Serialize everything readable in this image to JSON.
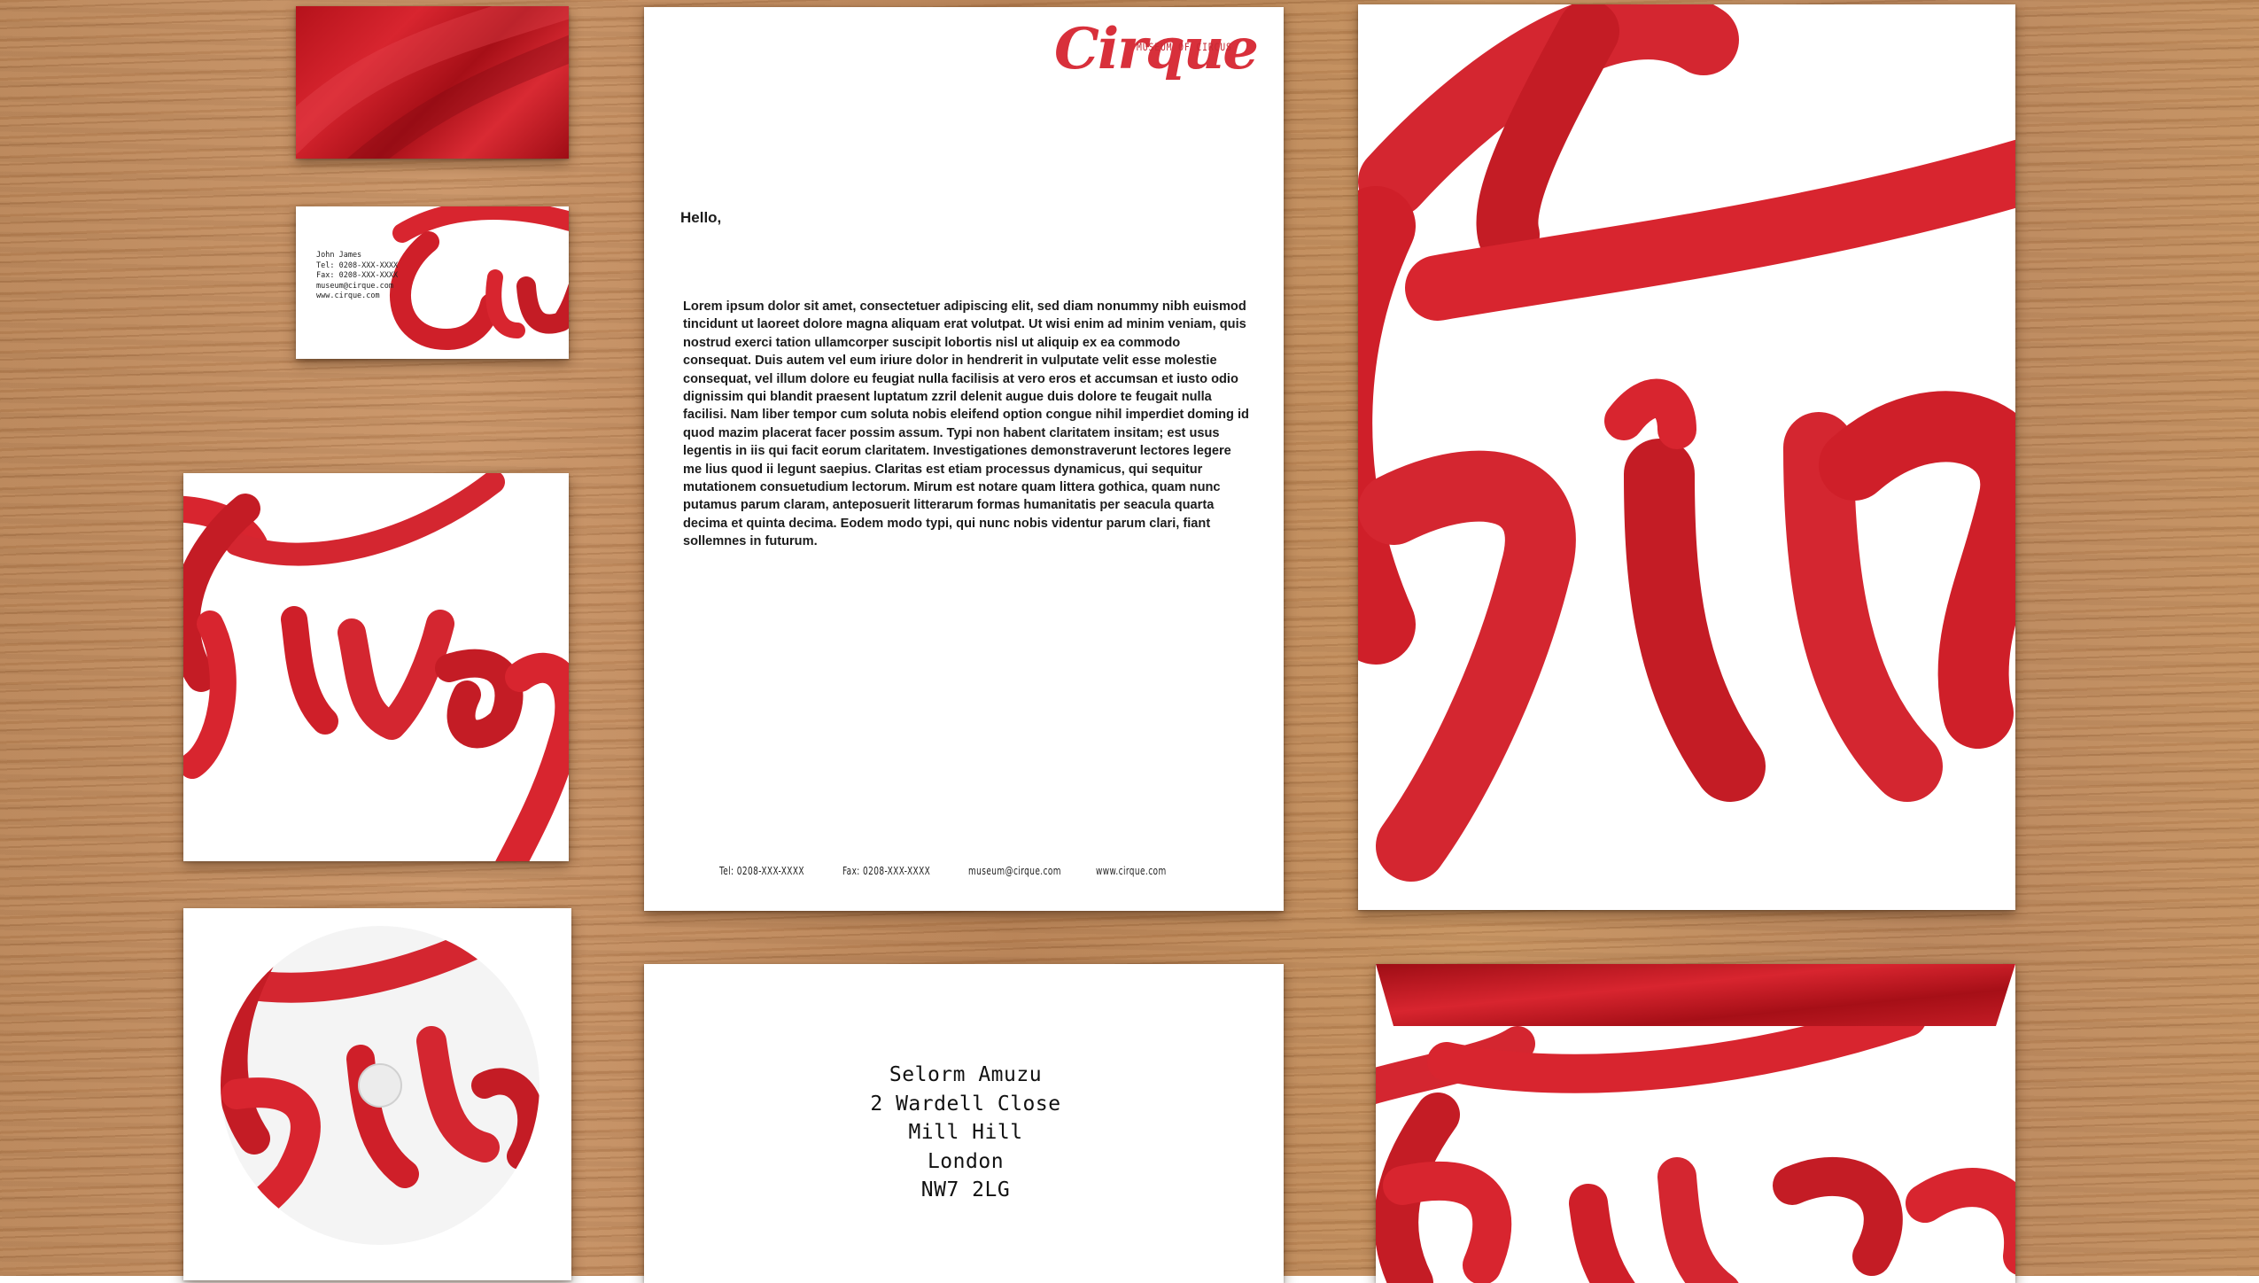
{
  "logo": {
    "wordmark": "Cirque",
    "tagline": "MUSEUM OF CIRCUS"
  },
  "business_card": {
    "lines": [
      "John James",
      "Tel: 0208-XXX-XXXX",
      "Fax: 0208-XXX-XXXX",
      "museum@cirque.com",
      "www.cirque.com"
    ]
  },
  "letterhead": {
    "greeting": "Hello,",
    "body": "Lorem ipsum dolor sit amet, consectetuer adipiscing elit, sed diam nonummy nibh euismod tincidunt ut laoreet dolore magna aliquam erat volutpat. Ut wisi enim ad minim veniam, quis nostrud exerci tation ullamcorper suscipit lobortis nisl ut aliquip ex ea commodo consequat. Duis autem vel eum iriure dolor in hendrerit in vulputate velit esse molestie consequat, vel illum dolore eu feugiat nulla facilisis at vero eros et accumsan et iusto odio dignissim qui blandit praesent luptatum zzril delenit augue duis dolore te feugait nulla facilisi. Nam liber tempor cum soluta nobis eleifend option congue nihil imperdiet doming id quod mazim placerat facer possim assum. Typi non habent claritatem insitam; est usus legentis in iis qui facit eorum claritatem. Investigationes demonstraverunt lectores legere me lius quod ii legunt saepius. Claritas est etiam processus dynamicus, qui sequitur mutationem consuetudium lectorum. Mirum est notare quam littera gothica, quam nunc putamus parum claram, anteposuerit litterarum formas humanitatis per seacula quarta decima et quinta decima. Eodem modo typi, qui nunc nobis videntur parum clari, fiant sollemnes in futurum.",
    "footer": {
      "tel": "Tel: 0208-XXX-XXXX",
      "fax": "Fax: 0208-XXX-XXXX",
      "email": "museum@cirque.com",
      "web": "www.cirque.com"
    }
  },
  "envelope": {
    "address": [
      "Selorm Amuzu",
      "2 Wardell Close",
      "Mill Hill",
      "London",
      "NW7 2LG"
    ]
  },
  "colors": {
    "brand_red": "#d8252f",
    "ribbon_dark": "#a8141c",
    "paper": "#ffffff",
    "wood": "#c08b5c"
  }
}
